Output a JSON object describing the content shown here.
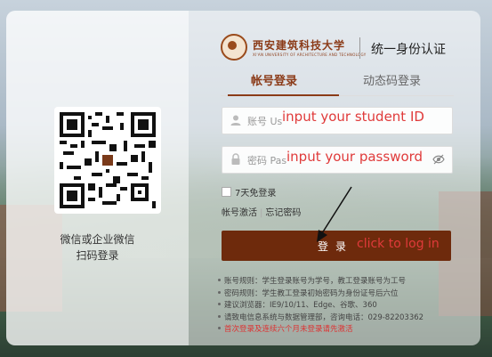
{
  "qr": {
    "caption_line1": "微信或企业微信",
    "caption_line2": "扫码登录"
  },
  "header": {
    "logo_cn": "西安建筑科技大学",
    "logo_en": "XI'AN UNIVERSITY OF ARCHITECTURE AND TECHNOLOGY",
    "system_title": "统一身份认证"
  },
  "tabs": [
    {
      "label": "帐号登录",
      "active": true
    },
    {
      "label": "动态码登录",
      "active": false
    }
  ],
  "form": {
    "username_placeholder": "账号 Us",
    "password_placeholder": "密码 Pas",
    "remember_label": "7天免登录",
    "activate_link": "帐号激活",
    "forgot_link": "忘记密码",
    "login_button": "登录"
  },
  "annotations": {
    "username_hint": "input your student ID",
    "password_hint": "input your password",
    "login_hint": "click to log in"
  },
  "rules": [
    "账号规则：学生登录账号为学号，教工登录账号为工号",
    "密码规则：学生教工登录初始密码为身份证号后六位",
    "建议浏览器：IE9/10/11、Edge、谷歌、360",
    "请致电信息系统与数据管理部，咨询电话：029-82203362",
    "首次登录及连续六个月未登录请先激活"
  ],
  "colors": {
    "brand": "#8b3b18",
    "button": "#6e2a0c",
    "annotation": "#e03a3a"
  }
}
